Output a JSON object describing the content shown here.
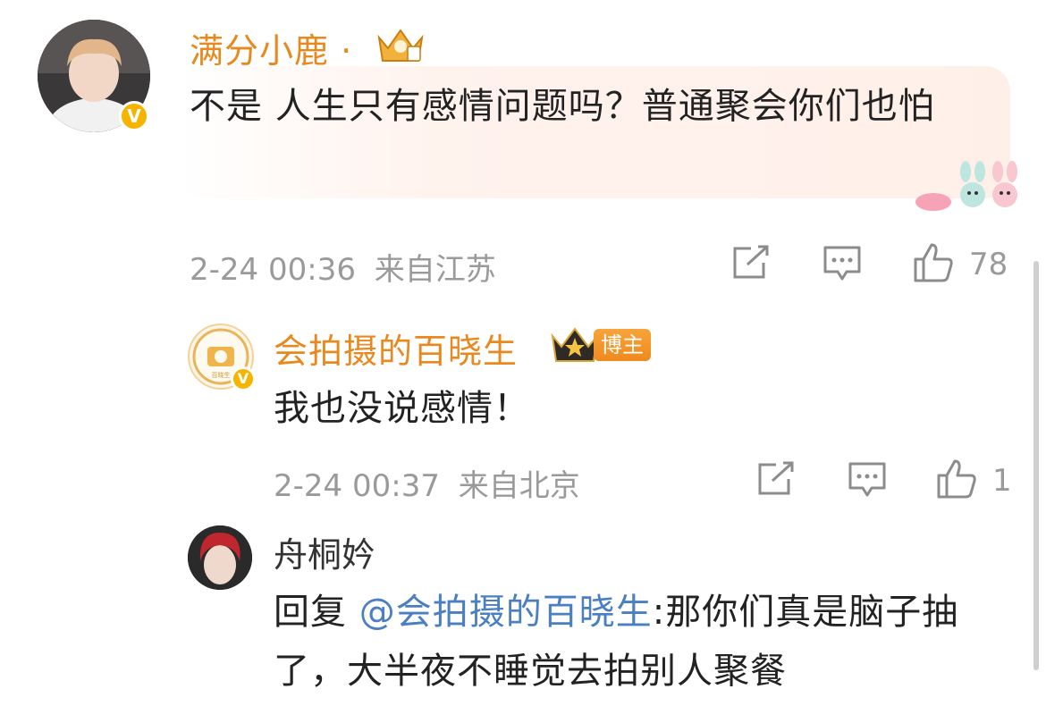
{
  "comment1": {
    "username": "满分小鹿",
    "name_dot": "·",
    "text": "不是 人生只有感情问题吗？普通聚会你们也怕",
    "timestamp": "2-24 00:36",
    "location": "来自江苏",
    "like_count": "78"
  },
  "reply1": {
    "username": "会拍摄的百晓生",
    "badge_label": "博主",
    "text": "我也没说感情！",
    "timestamp": "2-24 00:37",
    "location": "来自北京",
    "like_count": "1"
  },
  "reply2": {
    "username": "舟桐妗",
    "reply_prefix": "回复",
    "mention": "@会拍摄的百晓生",
    "text": ":那你们真是脑子抽了，大半夜不睡觉去拍别人聚餐"
  },
  "icons": [
    "verified-badge-icon",
    "crown-badge-icon",
    "share-icon",
    "comment-icon",
    "like-icon",
    "sticker-bunny-icon"
  ],
  "colors": {
    "username_orange": "#e8891f",
    "mention_blue": "#4a7fc2",
    "meta_gray": "#9a9a9a",
    "badge_gold": "#f6b400"
  }
}
